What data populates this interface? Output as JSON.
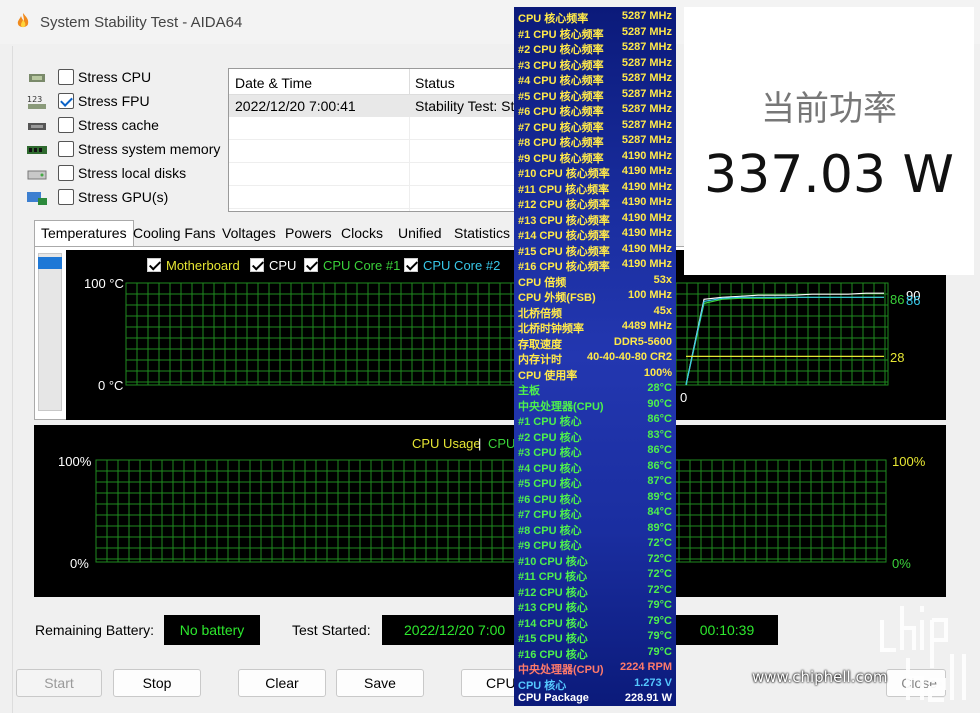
{
  "window": {
    "title": "System Stability Test - AIDA64"
  },
  "stress_options": [
    {
      "label": "Stress CPU",
      "checked": false,
      "icon": "cpu-chip-icon"
    },
    {
      "label": "Stress FPU",
      "checked": true,
      "icon": "fpu-123-icon"
    },
    {
      "label": "Stress cache",
      "checked": false,
      "icon": "cache-chip-icon"
    },
    {
      "label": "Stress system memory",
      "checked": false,
      "icon": "memory-module-icon"
    },
    {
      "label": "Stress local disks",
      "checked": false,
      "icon": "disk-drive-icon"
    },
    {
      "label": "Stress GPU(s)",
      "checked": false,
      "icon": "gpu-monitor-icon"
    }
  ],
  "log": {
    "columns": [
      "Date & Time",
      "Status"
    ],
    "rows": [
      {
        "datetime": "2022/12/20 7:00:41",
        "status": "Stability Test: St"
      }
    ]
  },
  "tabs": [
    "Temperatures",
    "Cooling Fans",
    "Voltages",
    "Powers",
    "Clocks",
    "Unified",
    "Statistics"
  ],
  "active_tab": "Temperatures",
  "temp_graph": {
    "legend": [
      {
        "label": "Motherboard",
        "color": "#e6e633"
      },
      {
        "label": "CPU",
        "color": "#ffffff"
      },
      {
        "label": "CPU Core #1",
        "color": "#3ad13a"
      },
      {
        "label": "CPU Core #2",
        "color": "#38c8e8"
      }
    ],
    "y_top": "100 °C",
    "y_bottom": "0 °C",
    "right_values": [
      "90",
      "86",
      "86",
      "28"
    ],
    "right_zero": "0",
    "series": {
      "cpu": [
        0,
        84,
        86,
        87,
        88,
        88,
        88,
        89,
        89,
        89,
        90,
        90
      ],
      "core1": [
        0,
        80,
        84,
        85,
        85,
        85,
        86,
        86,
        86,
        86,
        86,
        86
      ],
      "core2": [
        0,
        82,
        85,
        86,
        86,
        86,
        86,
        86,
        86,
        86,
        86,
        86
      ],
      "motherboard": [
        28,
        28,
        28,
        28,
        28,
        28,
        28,
        28,
        28,
        28,
        28,
        28
      ]
    }
  },
  "usage_graph": {
    "legend_usage": "CPU Usage",
    "legend_sep": "|",
    "legend_cpu": "CPU",
    "y_top_left": "100%",
    "y_bottom_left": "0%",
    "y_top_right": "100%",
    "y_bottom_right": "0%"
  },
  "status": {
    "battery_label": "Remaining Battery:",
    "battery_value": "No battery",
    "started_label": "Test Started:",
    "started_value": "2022/12/20 7:00",
    "elapsed_value": "00:10:39"
  },
  "buttons": {
    "start": "Start",
    "stop": "Stop",
    "clear": "Clear",
    "save": "Save",
    "cpuid": "CPU",
    "close": "Close"
  },
  "overlay": [
    {
      "k": "CPU 核心频率",
      "v": "5287 MHz",
      "color": "#ffe94a"
    },
    {
      "k": "#1 CPU 核心频率",
      "v": "5287 MHz",
      "color": "#ffe94a"
    },
    {
      "k": "#2 CPU 核心频率",
      "v": "5287 MHz",
      "color": "#ffe94a"
    },
    {
      "k": "#3 CPU 核心频率",
      "v": "5287 MHz",
      "color": "#ffe94a"
    },
    {
      "k": "#4 CPU 核心频率",
      "v": "5287 MHz",
      "color": "#ffe94a"
    },
    {
      "k": "#5 CPU 核心频率",
      "v": "5287 MHz",
      "color": "#ffe94a"
    },
    {
      "k": "#6 CPU 核心频率",
      "v": "5287 MHz",
      "color": "#ffe94a"
    },
    {
      "k": "#7 CPU 核心频率",
      "v": "5287 MHz",
      "color": "#ffe94a"
    },
    {
      "k": "#8 CPU 核心频率",
      "v": "5287 MHz",
      "color": "#ffe94a"
    },
    {
      "k": "#9 CPU 核心频率",
      "v": "4190 MHz",
      "color": "#ffe94a"
    },
    {
      "k": "#10 CPU 核心频率",
      "v": "4190 MHz",
      "color": "#ffe94a"
    },
    {
      "k": "#11 CPU 核心频率",
      "v": "4190 MHz",
      "color": "#ffe94a"
    },
    {
      "k": "#12 CPU 核心频率",
      "v": "4190 MHz",
      "color": "#ffe94a"
    },
    {
      "k": "#13 CPU 核心频率",
      "v": "4190 MHz",
      "color": "#ffe94a"
    },
    {
      "k": "#14 CPU 核心频率",
      "v": "4190 MHz",
      "color": "#ffe94a"
    },
    {
      "k": "#15 CPU 核心频率",
      "v": "4190 MHz",
      "color": "#ffe94a"
    },
    {
      "k": "#16 CPU 核心频率",
      "v": "4190 MHz",
      "color": "#ffe94a"
    },
    {
      "k": "CPU 倍频",
      "v": "53x",
      "color": "#ffe94a"
    },
    {
      "k": "CPU 外频(FSB)",
      "v": "100 MHz",
      "color": "#ffe94a"
    },
    {
      "k": "北桥倍频",
      "v": "45x",
      "color": "#ffe94a"
    },
    {
      "k": "北桥时钟频率",
      "v": "4489 MHz",
      "color": "#ffe94a"
    },
    {
      "k": "存取速度",
      "v": "DDR5-5600",
      "color": "#ffe94a"
    },
    {
      "k": "内存计时",
      "v": "40-40-40-80 CR2",
      "color": "#ffe94a"
    },
    {
      "k": "CPU 使用率",
      "v": "100%",
      "color": "#ffe94a"
    },
    {
      "k": "主板",
      "v": "28°C",
      "color": "#4df04d"
    },
    {
      "k": "中央处理器(CPU)",
      "v": "90°C",
      "color": "#4df04d"
    },
    {
      "k": " #1 CPU 核心",
      "v": "86°C",
      "color": "#4df04d"
    },
    {
      "k": " #2 CPU 核心",
      "v": "83°C",
      "color": "#4df04d"
    },
    {
      "k": " #3 CPU 核心",
      "v": "86°C",
      "color": "#4df04d"
    },
    {
      "k": " #4 CPU 核心",
      "v": "86°C",
      "color": "#4df04d"
    },
    {
      "k": " #5 CPU 核心",
      "v": "87°C",
      "color": "#4df04d"
    },
    {
      "k": " #6 CPU 核心",
      "v": "89°C",
      "color": "#4df04d"
    },
    {
      "k": " #7 CPU 核心",
      "v": "84°C",
      "color": "#4df04d"
    },
    {
      "k": " #8 CPU 核心",
      "v": "89°C",
      "color": "#4df04d"
    },
    {
      "k": " #9 CPU 核心",
      "v": "72°C",
      "color": "#4df04d"
    },
    {
      "k": " #10 CPU 核心",
      "v": "72°C",
      "color": "#4df04d"
    },
    {
      "k": " #11 CPU 核心",
      "v": "72°C",
      "color": "#4df04d"
    },
    {
      "k": " #12 CPU 核心",
      "v": "72°C",
      "color": "#4df04d"
    },
    {
      "k": " #13 CPU 核心",
      "v": "79°C",
      "color": "#4df04d"
    },
    {
      "k": " #14 CPU 核心",
      "v": "79°C",
      "color": "#4df04d"
    },
    {
      "k": " #15 CPU 核心",
      "v": "79°C",
      "color": "#4df04d"
    },
    {
      "k": " #16 CPU 核心",
      "v": "79°C",
      "color": "#4df04d"
    },
    {
      "k": "中央处理器(CPU)",
      "v": "2224 RPM",
      "color": "#ff7a6a"
    },
    {
      "k": "CPU 核心",
      "v": "1.273 V",
      "color": "#55c8ff"
    },
    {
      "k": "CPU Package",
      "v": "228.91 W",
      "color": "#ffffff"
    }
  ],
  "power_card": {
    "title": "当前功率",
    "value": "337.03 W"
  },
  "watermark": {
    "text": "www.chiphell.com"
  }
}
